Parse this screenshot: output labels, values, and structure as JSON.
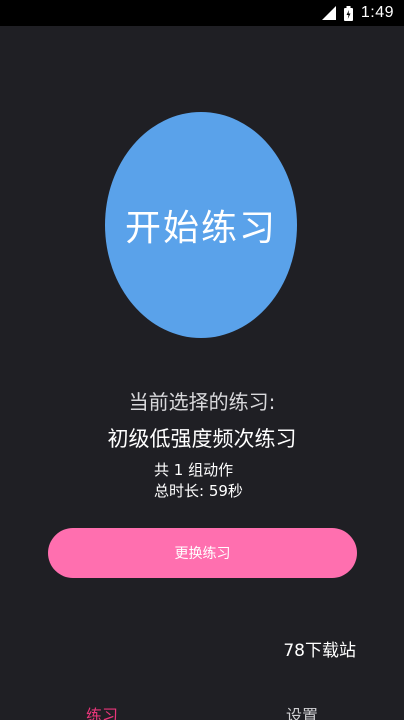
{
  "status_bar": {
    "time": "1:49",
    "icons": [
      "signal-icon",
      "battery-icon"
    ]
  },
  "main": {
    "start_button_label": "开始练习",
    "current_selection_label": "当前选择的练习:",
    "exercise_name": "初级低强度频次练习",
    "group_count_text": "共 1 组动作",
    "total_duration_text": "总时长: 59秒",
    "change_button_label": "更换练习"
  },
  "watermark": {
    "text": "78下载站"
  },
  "bottom_nav": {
    "tabs": [
      {
        "label": "练习",
        "active": true
      },
      {
        "label": "设置",
        "active": false
      }
    ]
  },
  "colors": {
    "background": "#1f1f24",
    "circle": "#5aa2ea",
    "button": "#ff6faf",
    "active_tab": "#e8367a"
  }
}
